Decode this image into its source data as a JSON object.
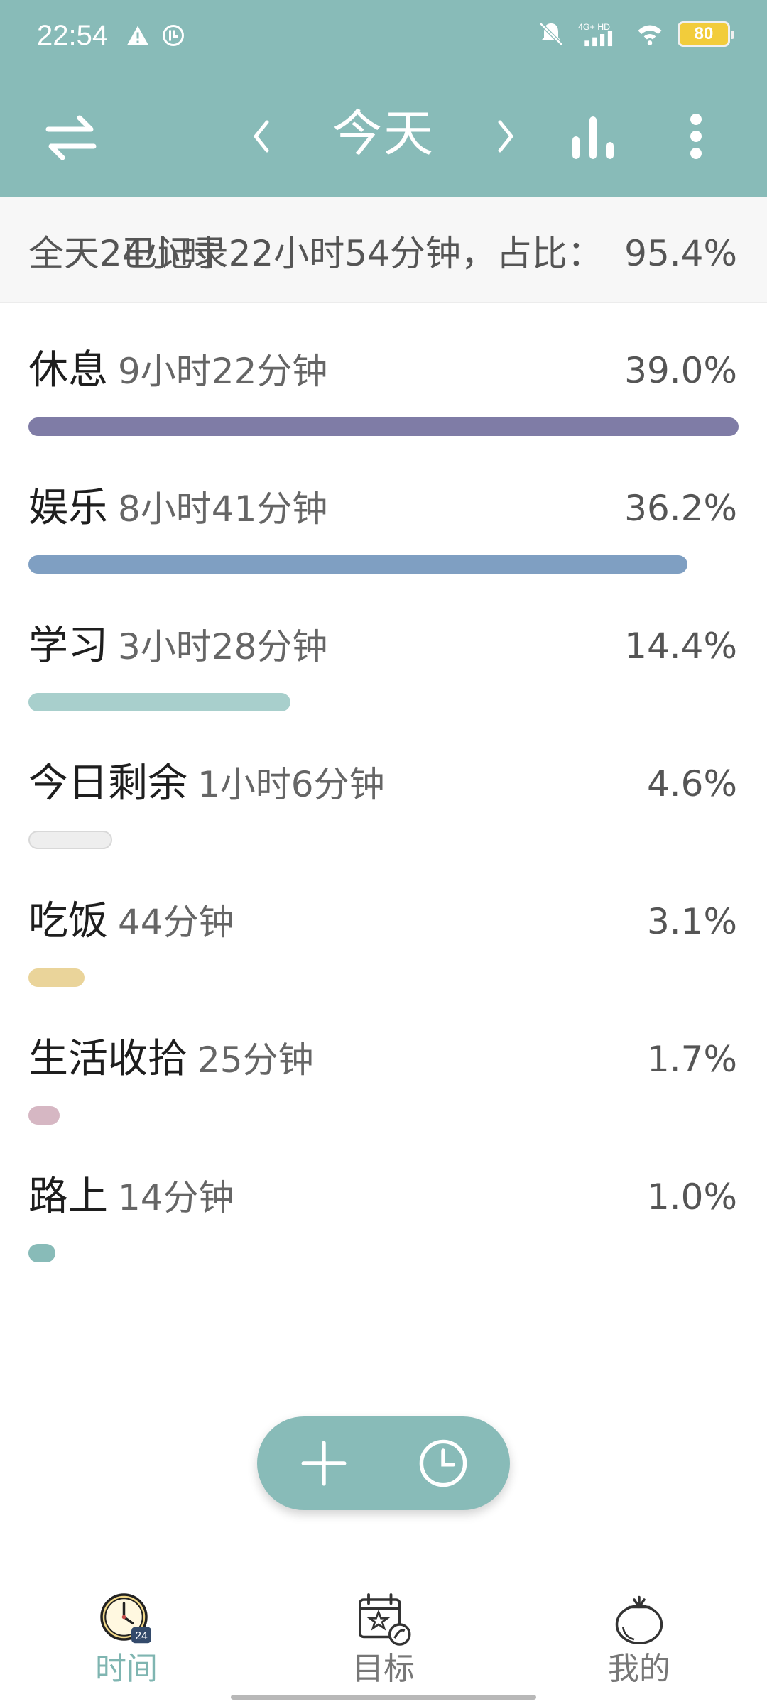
{
  "status_bar": {
    "time": "22:54",
    "network": "4G+ HD",
    "battery": "80"
  },
  "toolbar": {
    "title": "今天",
    "swap_icon": "swap-arrows-icon",
    "prev_icon": "chevron-left-icon",
    "next_icon": "chevron-right-icon",
    "chart_icon": "bar-chart-icon",
    "more_icon": "more-vertical-icon"
  },
  "summary": {
    "left": "全天24小时",
    "middle": "已记录22小时54分钟，占比：",
    "percent": "95.4%"
  },
  "categories": [
    {
      "name": "休息",
      "duration": "9小时22分钟",
      "percent": "39.0%",
      "ratio": 1.0,
      "color": "#7f7ca6"
    },
    {
      "name": "娱乐",
      "duration": "8小时41分钟",
      "percent": "36.2%",
      "ratio": 0.928,
      "color": "#7f9fc2"
    },
    {
      "name": "学习",
      "duration": "3小时28分钟",
      "percent": "14.4%",
      "ratio": 0.369,
      "color": "#a8cfcc"
    },
    {
      "name": "今日剩余",
      "duration": "1小时6分钟",
      "percent": "4.6%",
      "ratio": 0.118,
      "color": "#eeeeee"
    },
    {
      "name": "吃饭",
      "duration": "44分钟",
      "percent": "3.1%",
      "ratio": 0.079,
      "color": "#ead49a"
    },
    {
      "name": "生活收拾",
      "duration": "25分钟",
      "percent": "1.7%",
      "ratio": 0.044,
      "color": "#d6b7c3"
    },
    {
      "name": "路上",
      "duration": "14分钟",
      "percent": "1.0%",
      "ratio": 0.038,
      "color": "#88bbb8"
    }
  ],
  "fab": {
    "add_icon": "plus-icon",
    "timer_icon": "clock-icon"
  },
  "bottom_nav": [
    {
      "label": "时间",
      "icon": "clock-24-icon",
      "active": true
    },
    {
      "label": "目标",
      "icon": "calendar-goal-icon",
      "active": false
    },
    {
      "label": "我的",
      "icon": "tomato-icon",
      "active": false
    }
  ],
  "colors": {
    "primary": "#88bbb8",
    "active_nav": "#7fb5b1"
  }
}
